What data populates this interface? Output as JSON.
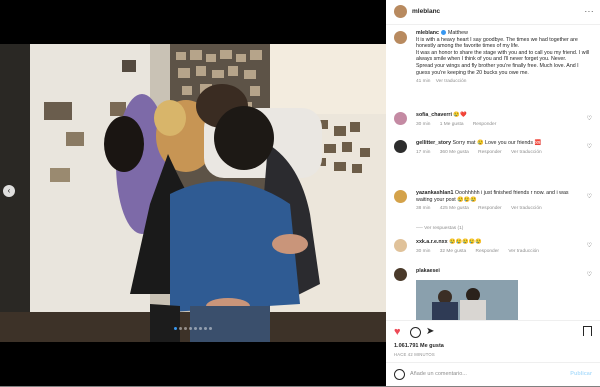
{
  "post": {
    "username": "mleblanc",
    "caption_author": "mleblanc",
    "caption_mention": "Matthew",
    "caption_lines": [
      "It is with a heavy heart I say goodbye. The times we had together are honestly among the favorite times of my life.",
      "It was an honor to share the stage with you and to call you my friend. I will always smile when I think of you and I'll never forget you. Never.",
      "Spread your wings and fly brother you're finally free. Much love. And I guess you're keeping the 20 bucks you owe me."
    ],
    "caption_age": "41 min",
    "caption_translate": "Ver traducción",
    "likes": "1.061.791 Me gusta",
    "time": "HACE 42 MINUTOS",
    "add_comment_placeholder": "Añade un comentario...",
    "publish_label": "Publicar",
    "more_menu": "···"
  },
  "comments": [
    {
      "user": "sofia_chaverri",
      "text": "😢❤️",
      "age": "30 min",
      "likes": "1 Me gusta",
      "reply": "Responder",
      "translate": ""
    },
    {
      "user": "gellitter_story",
      "text": "Sorry mat 😢 Love you our friends 🆘",
      "age": "17 min",
      "likes": "360 Me gusta",
      "reply": "Responder",
      "translate": "Ver traducción"
    },
    {
      "user": "yazankashlan1",
      "text": "Ooohhhhh i just finished friends r now. and i was waiting your post 😢😢😢",
      "age": "38 min",
      "likes": "425 Me gusta",
      "reply": "Responder",
      "translate": "Ver traducción"
    },
    {
      "user": "xxk.a.r.e.nxx",
      "text": "😢😢😢😢😢",
      "age": "30 min",
      "likes": "32 Me gusta",
      "reply": "Responder",
      "translate": "Ver traducción"
    },
    {
      "user": "plakaesei",
      "text": "",
      "age": "",
      "likes": "",
      "reply": "",
      "translate": ""
    }
  ],
  "view_replies": "Ver respuestas (1)",
  "colors": {
    "accent": "#3897f0",
    "text": "#262626",
    "muted": "#8e8e8e",
    "heart": "#ed4956"
  }
}
